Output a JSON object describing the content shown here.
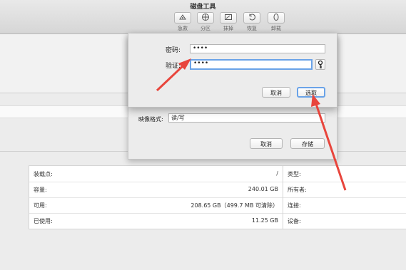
{
  "window": {
    "title": "磁盘工具"
  },
  "toolbar": {
    "items": [
      {
        "label": "急救",
        "icon": "first-aid-icon"
      },
      {
        "label": "分区",
        "icon": "partition-icon"
      },
      {
        "label": "抹掉",
        "icon": "erase-icon"
      },
      {
        "label": "恢复",
        "icon": "restore-icon"
      },
      {
        "label": "卸载",
        "icon": "unmount-icon"
      }
    ]
  },
  "sheet": {
    "image_format_label": "映像格式:",
    "image_format_value": "读/写",
    "cancel_label": "取消",
    "save_label": "存储"
  },
  "password_dialog": {
    "password_label": "密码:",
    "password_value": "••••",
    "verify_label": "验证:",
    "verify_value": "••••",
    "cancel_label": "取消",
    "choose_label": "选取"
  },
  "info": {
    "left_rows": [
      {
        "key": "装载点:",
        "value": "/"
      },
      {
        "key": "容量:",
        "value": "240.01 GB"
      },
      {
        "key": "可用:",
        "value": "208.65 GB（499.7 MB 可清除）"
      },
      {
        "key": "已使用:",
        "value": "11.25 GB"
      }
    ],
    "right_rows": [
      {
        "key": "类型:"
      },
      {
        "key": "所有者:"
      },
      {
        "key": "连接:"
      },
      {
        "key": "设备:"
      }
    ]
  },
  "colors": {
    "accent": "#6aa3e8",
    "annotation_arrow": "#e8453c"
  }
}
